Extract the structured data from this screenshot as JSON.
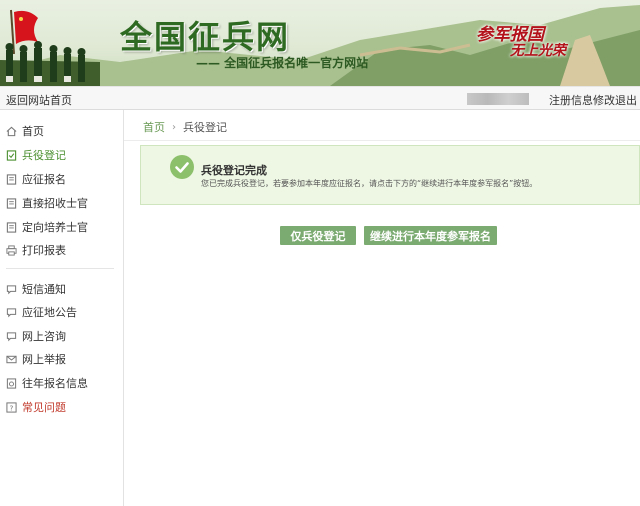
{
  "header": {
    "site_title": "全国征兵网",
    "site_subtitle": "—— 全国征兵报名唯一官方网站",
    "slogan_line1": "参军报国",
    "slogan_line2": "无上光荣"
  },
  "topbar": {
    "back_label": "返回网站首页",
    "edit_label": "注册信息修改",
    "logout_label": "退出"
  },
  "sidebar": {
    "items": [
      {
        "label": "首页",
        "icon": "home-icon",
        "state": "normal"
      },
      {
        "label": "兵役登记",
        "icon": "register-icon",
        "state": "active"
      },
      {
        "label": "应征报名",
        "icon": "document-icon",
        "state": "normal"
      },
      {
        "label": "直接招收士官",
        "icon": "document-icon",
        "state": "normal"
      },
      {
        "label": "定向培养士官",
        "icon": "document-icon",
        "state": "normal"
      },
      {
        "label": "打印报表",
        "icon": "printer-icon",
        "state": "normal"
      },
      {
        "label": "短信通知",
        "icon": "message-icon",
        "state": "normal"
      },
      {
        "label": "应征地公告",
        "icon": "message-icon",
        "state": "normal"
      },
      {
        "label": "网上咨询",
        "icon": "message-icon",
        "state": "normal"
      },
      {
        "label": "网上举报",
        "icon": "mail-icon",
        "state": "normal"
      },
      {
        "label": "往年报名信息",
        "icon": "history-icon",
        "state": "normal"
      },
      {
        "label": "常见问题",
        "icon": "question-icon",
        "state": "highlight"
      }
    ]
  },
  "breadcrumb": {
    "home": "首页",
    "current": "兵役登记"
  },
  "notice": {
    "title": "兵役登记完成",
    "description": "您已完成兵役登记，若要参加本年度应征报名，请点击下方的“继续进行本年度参军报名”按钮。"
  },
  "actions": {
    "register_only": "仅兵役登记",
    "continue": "继续进行本年度参军报名"
  },
  "colors": {
    "accent_green": "#7cab72",
    "active_green": "#4a8f2f",
    "faq_red": "#c0392b",
    "notice_bg": "#eef7e4"
  }
}
